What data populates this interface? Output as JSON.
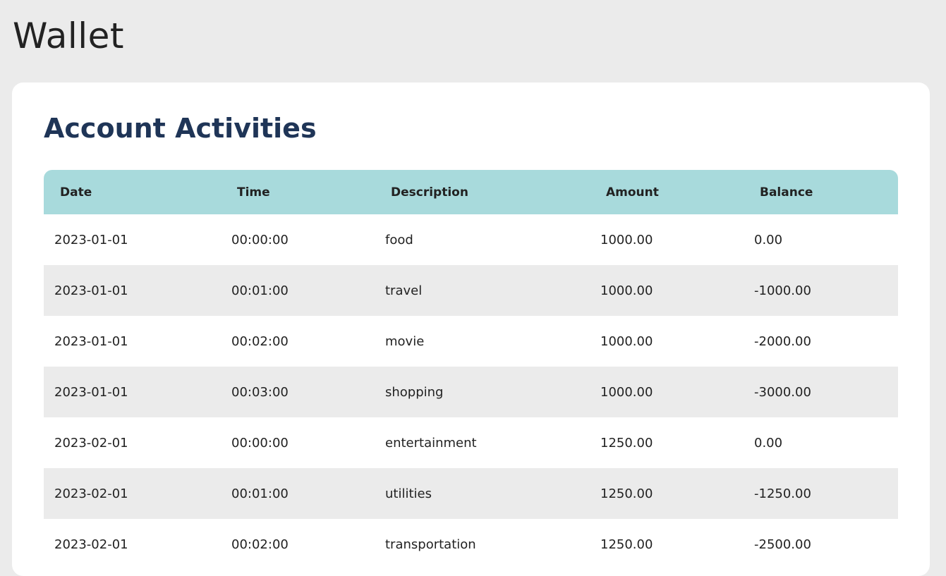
{
  "page": {
    "title": "Wallet"
  },
  "card": {
    "title": "Account Activities"
  },
  "table": {
    "headers": [
      "Date",
      "Time",
      "Description",
      "Amount",
      "Balance"
    ],
    "rows": [
      [
        "2023-01-01",
        "00:00:00",
        "food",
        "1000.00",
        "0.00"
      ],
      [
        "2023-01-01",
        "00:01:00",
        "travel",
        "1000.00",
        "-1000.00"
      ],
      [
        "2023-01-01",
        "00:02:00",
        "movie",
        "1000.00",
        "-2000.00"
      ],
      [
        "2023-01-01",
        "00:03:00",
        "shopping",
        "1000.00",
        "-3000.00"
      ],
      [
        "2023-02-01",
        "00:00:00",
        "entertainment",
        "1250.00",
        "0.00"
      ],
      [
        "2023-02-01",
        "00:01:00",
        "utilities",
        "1250.00",
        "-1250.00"
      ],
      [
        "2023-02-01",
        "00:02:00",
        "transportation",
        "1250.00",
        "-2500.00"
      ]
    ]
  },
  "colors": {
    "background": "#ebebeb",
    "card": "#ffffff",
    "header_row": "#a8dadc",
    "card_title": "#1f3557",
    "striped_row": "#ebebeb",
    "text": "#222222"
  }
}
